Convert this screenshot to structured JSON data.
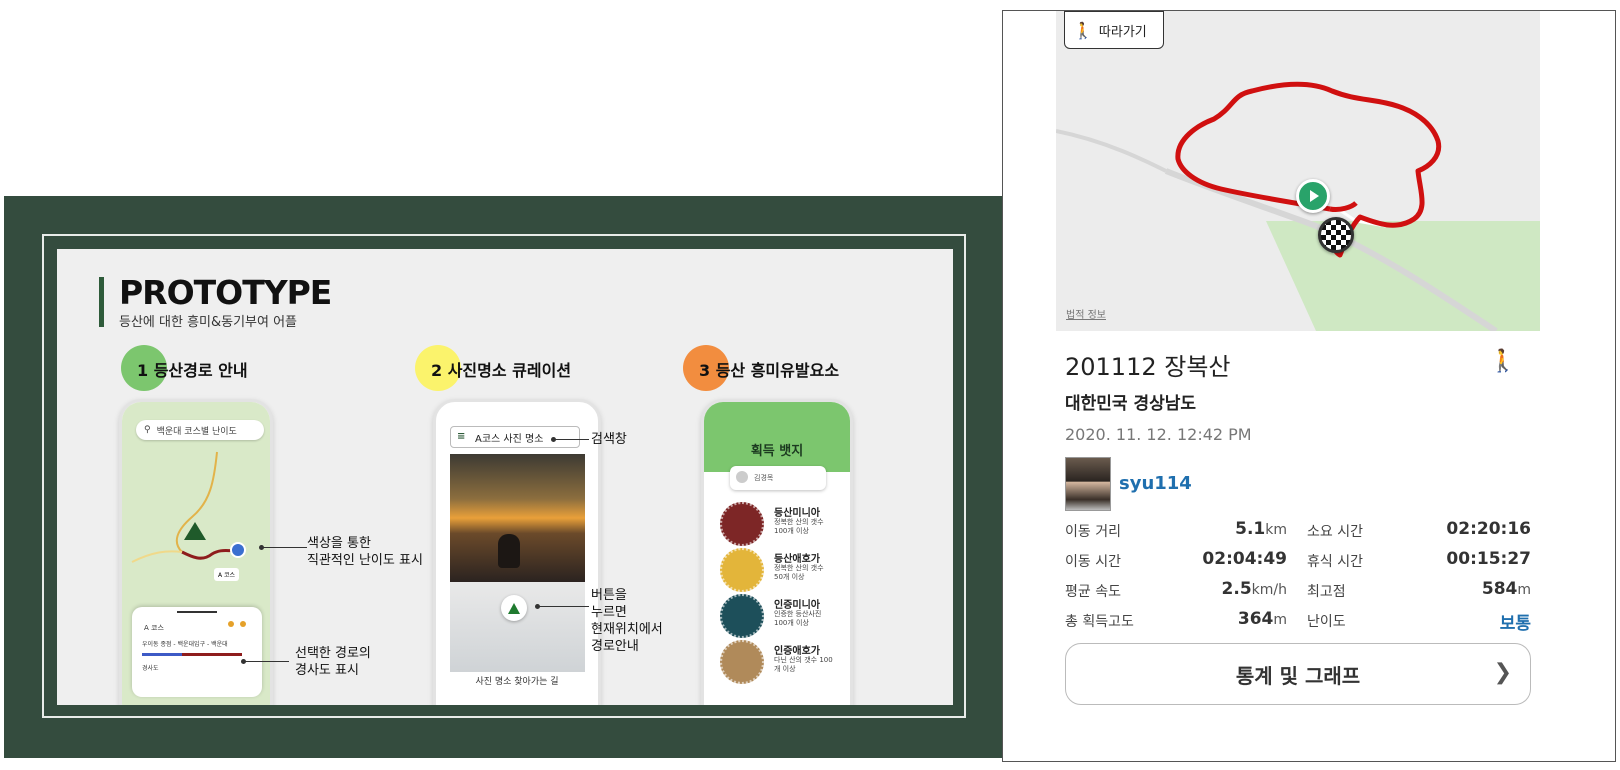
{
  "slide": {
    "title": "PROTOTYPE",
    "subtitle": "등산에 대한 흥미&동기부여 어플",
    "sections": [
      {
        "label": "1 등산경로 안내",
        "color": "#7cc66e"
      },
      {
        "label": "2 사진명소 큐레이션",
        "color": "#fbf36c"
      },
      {
        "label": "3 등산 흥미유발요소",
        "color": "#f28d3f"
      }
    ],
    "phone1": {
      "search_text": "백운대 코스별 난이도",
      "marker_label": "A 코스",
      "sheet_title": "A 코스",
      "sheet_route": "우이동 종점 - 백운대입구 - 백운대",
      "sheet_info": "경사도"
    },
    "phone2": {
      "search_text": "A코스 사진 명소",
      "footer": "사진 명소 찾아가는 길"
    },
    "phone3": {
      "title": "획득 뱃지",
      "user_name": "김경목",
      "badges": [
        {
          "name": "등산미니아",
          "desc": "정복한 산의 갯수 100개 이상",
          "color": "#7d2626"
        },
        {
          "name": "등산애호가",
          "desc": "정복한 산의 갯수 50개 이상",
          "color": "#e3b53a"
        },
        {
          "name": "인증미니아",
          "desc": "인증한 등산사진 100개 이상",
          "color": "#1d4f5a"
        },
        {
          "name": "인증애호가",
          "desc": "다닌 산의 갯수 100개 이상",
          "color": "#b08a5a"
        }
      ]
    },
    "notes": {
      "difficulty": "색상을 통한\n직관적인 난이도 표시",
      "slope": "선택한 경로의\n경사도 표시",
      "search": "검색창",
      "button": "버튼을\n누르면\n현재위치에서\n경로안내"
    }
  },
  "record": {
    "follow_label": "따라가기",
    "legal_label": "법적 정보",
    "title": "201112 장복산",
    "region": "대한민국 경상남도",
    "datetime": "2020. 11. 12. 12:42 PM",
    "username": "syu114",
    "stats": [
      {
        "label": "이동 거리",
        "value": "5.1",
        "unit": "km"
      },
      {
        "label": "소요 시간",
        "value": "02:20:16",
        "unit": ""
      },
      {
        "label": "이동 시간",
        "value": "02:04:49",
        "unit": ""
      },
      {
        "label": "휴식 시간",
        "value": "00:15:27",
        "unit": ""
      },
      {
        "label": "평균 속도",
        "value": "2.5",
        "unit": "km/h"
      },
      {
        "label": "최고점",
        "value": "584",
        "unit": "m"
      },
      {
        "label": "총 획득고도",
        "value": "364",
        "unit": "m"
      },
      {
        "label": "난이도",
        "value": "보통",
        "unit": ""
      }
    ],
    "stats_button": "통계 및 그래프",
    "accent_color": "#1f6fae",
    "route_color": "#d01010"
  }
}
